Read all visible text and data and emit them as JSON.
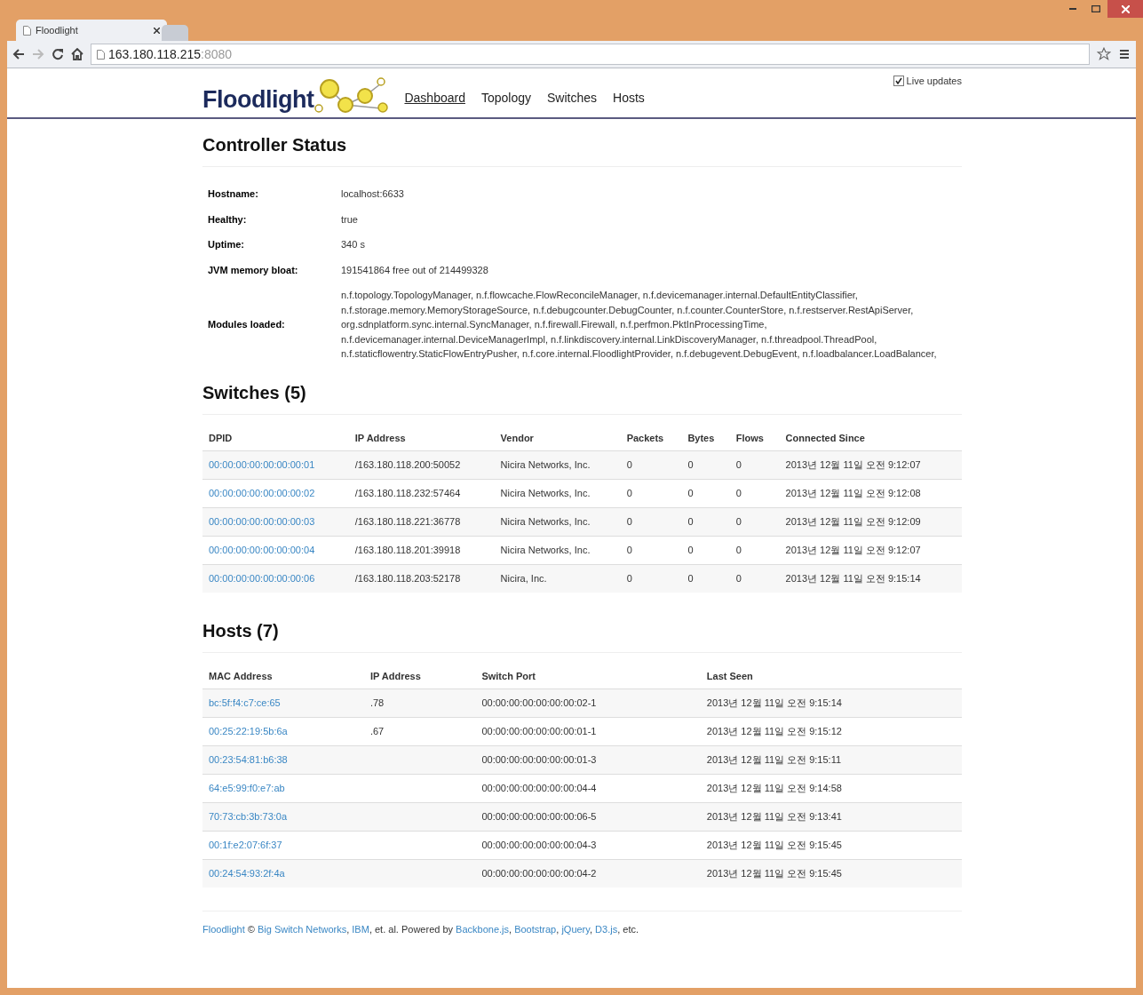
{
  "browser": {
    "tabs": [
      {
        "title": "Floodlight",
        "selected": true
      },
      {
        "selected": false
      }
    ],
    "url_host": "163.180.118.215",
    "url_port": ":8080"
  },
  "header": {
    "logo": "Floodlight",
    "nav": [
      {
        "label": "Dashboard",
        "selected": true
      },
      {
        "label": "Topology",
        "selected": false
      },
      {
        "label": "Switches",
        "selected": false
      },
      {
        "label": "Hosts",
        "selected": false
      }
    ],
    "live_updates": {
      "label": "Live updates",
      "checked": true
    }
  },
  "controller_status": {
    "title": "Controller Status",
    "rows": [
      {
        "label": "Hostname:",
        "value": "localhost:6633"
      },
      {
        "label": "Healthy:",
        "value": "true"
      },
      {
        "label": "Uptime:",
        "value": "340 s"
      },
      {
        "label": "JVM memory bloat:",
        "value": "191541864 free out of 214499328"
      },
      {
        "label": "Modules loaded:",
        "value": "n.f.topology.TopologyManager, n.f.flowcache.FlowReconcileManager, n.f.devicemanager.internal.DefaultEntityClassifier, n.f.storage.memory.MemoryStorageSource, n.f.debugcounter.DebugCounter, n.f.counter.CounterStore, n.f.restserver.RestApiServer, org.sdnplatform.sync.internal.SyncManager, n.f.firewall.Firewall, n.f.perfmon.PktInProcessingTime, n.f.devicemanager.internal.DeviceManagerImpl, n.f.linkdiscovery.internal.LinkDiscoveryManager, n.f.threadpool.ThreadPool, n.f.staticflowentry.StaticFlowEntryPusher, n.f.core.internal.FloodlightProvider, n.f.debugevent.DebugEvent, n.f.loadbalancer.LoadBalancer,"
      }
    ]
  },
  "switches": {
    "title": "Switches (5)",
    "columns": [
      "DPID",
      "IP Address",
      "Vendor",
      "Packets",
      "Bytes",
      "Flows",
      "Connected Since"
    ],
    "rows": [
      [
        "00:00:00:00:00:00:00:01",
        "/163.180.118.200:50052",
        "Nicira Networks, Inc.",
        "0",
        "0",
        "0",
        "2013년 12월 11일 오전 9:12:07"
      ],
      [
        "00:00:00:00:00:00:00:02",
        "/163.180.118.232:57464",
        "Nicira Networks, Inc.",
        "0",
        "0",
        "0",
        "2013년 12월 11일 오전 9:12:08"
      ],
      [
        "00:00:00:00:00:00:00:03",
        "/163.180.118.221:36778",
        "Nicira Networks, Inc.",
        "0",
        "0",
        "0",
        "2013년 12월 11일 오전 9:12:09"
      ],
      [
        "00:00:00:00:00:00:00:04",
        "/163.180.118.201:39918",
        "Nicira Networks, Inc.",
        "0",
        "0",
        "0",
        "2013년 12월 11일 오전 9:12:07"
      ],
      [
        "00:00:00:00:00:00:00:06",
        "/163.180.118.203:52178",
        "Nicira, Inc.",
        "0",
        "0",
        "0",
        "2013년 12월 11일 오전 9:15:14"
      ]
    ]
  },
  "hosts": {
    "title": "Hosts (7)",
    "columns": [
      "MAC Address",
      "IP Address",
      "Switch Port",
      "Last Seen"
    ],
    "rows": [
      [
        "bc:5f:f4:c7:ce:65",
        ".78",
        "00:00:00:00:00:00:00:02-1",
        "2013년 12월 11일 오전 9:15:14"
      ],
      [
        "00:25:22:19:5b:6a",
        ".67",
        "00:00:00:00:00:00:00:01-1",
        "2013년 12월 11일 오전 9:15:12"
      ],
      [
        "00:23:54:81:b6:38",
        "",
        "00:00:00:00:00:00:00:01-3",
        "2013년 12월 11일 오전 9:15:11"
      ],
      [
        "64:e5:99:f0:e7:ab",
        "",
        "00:00:00:00:00:00:00:04-4",
        "2013년 12월 11일 오전 9:14:58"
      ],
      [
        "70:73:cb:3b:73:0a",
        "",
        "00:00:00:00:00:00:00:06-5",
        "2013년 12월 11일 오전 9:13:41"
      ],
      [
        "00:1f:e2:07:6f:37",
        "",
        "00:00:00:00:00:00:00:04-3",
        "2013년 12월 11일 오전 9:15:45"
      ],
      [
        "00:24:54:93:2f:4a",
        "",
        "00:00:00:00:00:00:00:04-2",
        "2013년 12월 11일 오전 9:15:45"
      ]
    ]
  },
  "footer": [
    {
      "text": "Floodlight",
      "link": true
    },
    {
      "text": " © ",
      "link": false
    },
    {
      "text": "Big Switch Networks",
      "link": true
    },
    {
      "text": ", ",
      "link": false
    },
    {
      "text": "IBM",
      "link": true
    },
    {
      "text": ", et. al. Powered by ",
      "link": false
    },
    {
      "text": "Backbone.js",
      "link": true
    },
    {
      "text": ", ",
      "link": false
    },
    {
      "text": "Bootstrap",
      "link": true
    },
    {
      "text": ", ",
      "link": false
    },
    {
      "text": "jQuery",
      "link": true
    },
    {
      "text": ", ",
      "link": false
    },
    {
      "text": "D3.js",
      "link": true
    },
    {
      "text": ", etc.",
      "link": false
    }
  ]
}
